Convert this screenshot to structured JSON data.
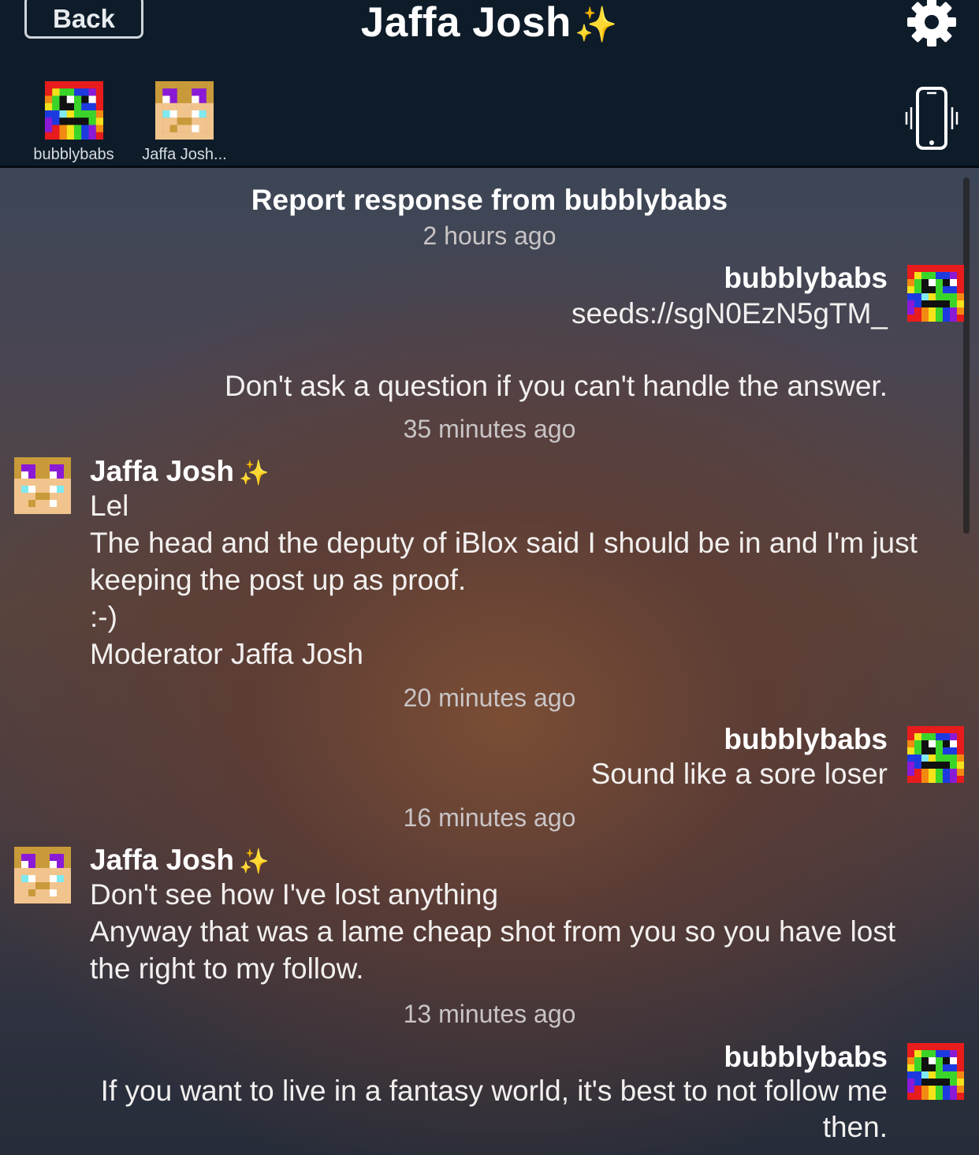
{
  "header": {
    "back_label": "Back",
    "title": "Jaffa Josh",
    "title_sparkle": "✨",
    "members": [
      {
        "label": "bubblybabs",
        "avatar": "rainbow-pixel-avatar"
      },
      {
        "label": "Jaffa Josh...",
        "avatar": "tan-pixel-avatar"
      }
    ]
  },
  "chat": {
    "report_title": "Report response from bubblybabs",
    "report_time": "2 hours ago",
    "messages": [
      {
        "author": "bubblybabs",
        "side": "right",
        "lines": [
          "seeds://sgN0EzN5gTM_",
          "",
          "Don't ask a question if you can't handle the answer."
        ]
      },
      {
        "time": "35 minutes ago"
      },
      {
        "author": "Jaffa Josh",
        "sparkle": "✨",
        "side": "left",
        "lines": [
          "Lel",
          "The head and the deputy of iBlox said I should be in and I'm just",
          "keeping the post up as proof.",
          ":-)",
          "Moderator Jaffa Josh"
        ]
      },
      {
        "time": "20 minutes ago"
      },
      {
        "author": "bubblybabs",
        "side": "right",
        "lines": [
          "Sound like a sore loser"
        ]
      },
      {
        "time": "16 minutes ago"
      },
      {
        "author": "Jaffa Josh",
        "sparkle": "✨",
        "side": "left",
        "lines": [
          "Don't see how I've lost anything",
          "Anyway that was a lame cheap shot from you so you have lost",
          "the right to my follow."
        ]
      },
      {
        "time": "13 minutes ago"
      },
      {
        "author": "bubblybabs",
        "side": "right",
        "lines": [
          "If you want to live in a fantasy world, it's best to not follow me",
          "then."
        ]
      }
    ]
  },
  "icons": {
    "settings": "gear-icon",
    "vibrate": "phone-vibrate-icon"
  }
}
